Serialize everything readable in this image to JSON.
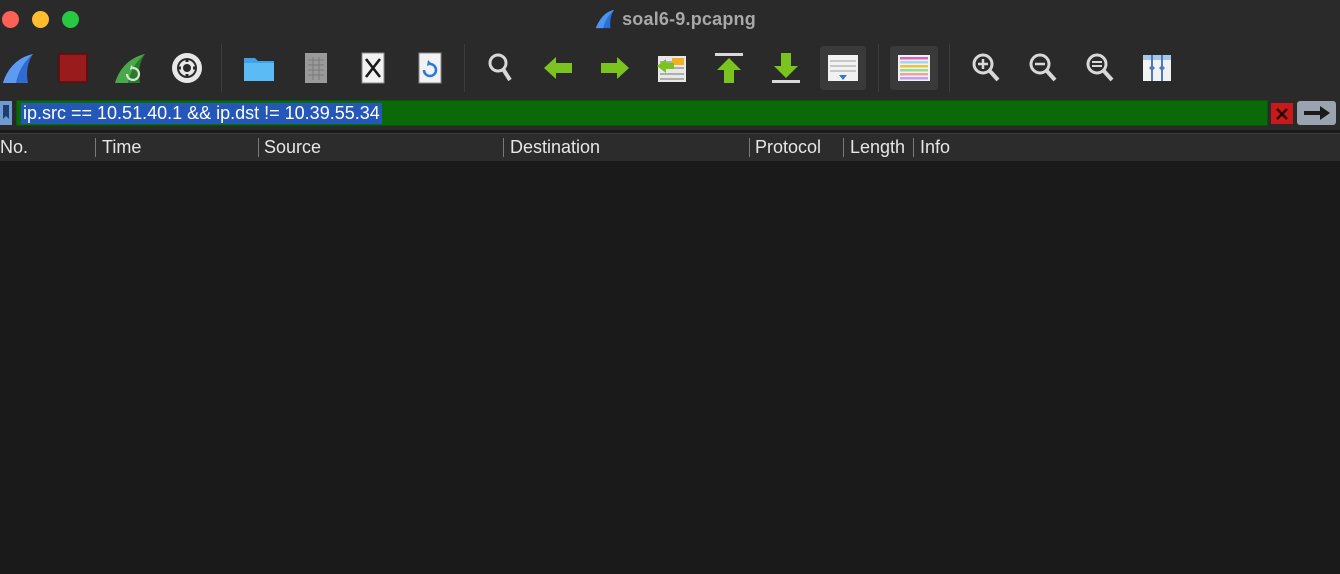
{
  "window": {
    "title": "soal6-9.pcapng"
  },
  "toolbar": {
    "buttons": [
      {
        "name": "start-capture-button",
        "icon": "shark-fin-icon"
      },
      {
        "name": "stop-capture-button",
        "icon": "stop-square-icon"
      },
      {
        "name": "restart-capture-button",
        "icon": "restart-fin-icon"
      },
      {
        "name": "capture-options-button",
        "icon": "gear-icon"
      },
      {
        "name": "open-file-button",
        "icon": "folder-icon"
      },
      {
        "name": "save-file-button",
        "icon": "file-icon"
      },
      {
        "name": "close-file-button",
        "icon": "close-file-icon"
      },
      {
        "name": "reload-file-button",
        "icon": "reload-icon"
      },
      {
        "name": "find-packet-button",
        "icon": "magnifier-icon"
      },
      {
        "name": "go-back-button",
        "icon": "arrow-left-icon"
      },
      {
        "name": "go-forward-button",
        "icon": "arrow-right-icon"
      },
      {
        "name": "go-to-packet-button",
        "icon": "go-to-packet-icon"
      },
      {
        "name": "first-packet-button",
        "icon": "arrow-up-bar-icon"
      },
      {
        "name": "last-packet-button",
        "icon": "arrow-down-bar-icon"
      },
      {
        "name": "auto-scroll-button",
        "icon": "auto-scroll-icon"
      },
      {
        "name": "colorize-button",
        "icon": "colorize-lines-icon"
      },
      {
        "name": "zoom-in-button",
        "icon": "zoom-in-icon"
      },
      {
        "name": "zoom-out-button",
        "icon": "zoom-out-icon"
      },
      {
        "name": "normal-size-button",
        "icon": "zoom-reset-icon"
      },
      {
        "name": "resize-columns-button",
        "icon": "resize-columns-icon"
      }
    ]
  },
  "filter": {
    "value": "ip.src == 10.51.40.1 && ip.dst != 10.39.55.34",
    "bg_color": "#0a6a0a"
  },
  "columns": [
    {
      "key": "no",
      "label": "No."
    },
    {
      "key": "time",
      "label": "Time"
    },
    {
      "key": "source",
      "label": "Source"
    },
    {
      "key": "destination",
      "label": "Destination"
    },
    {
      "key": "protocol",
      "label": "Protocol"
    },
    {
      "key": "length",
      "label": "Length"
    },
    {
      "key": "info",
      "label": "Info"
    }
  ],
  "packets": []
}
